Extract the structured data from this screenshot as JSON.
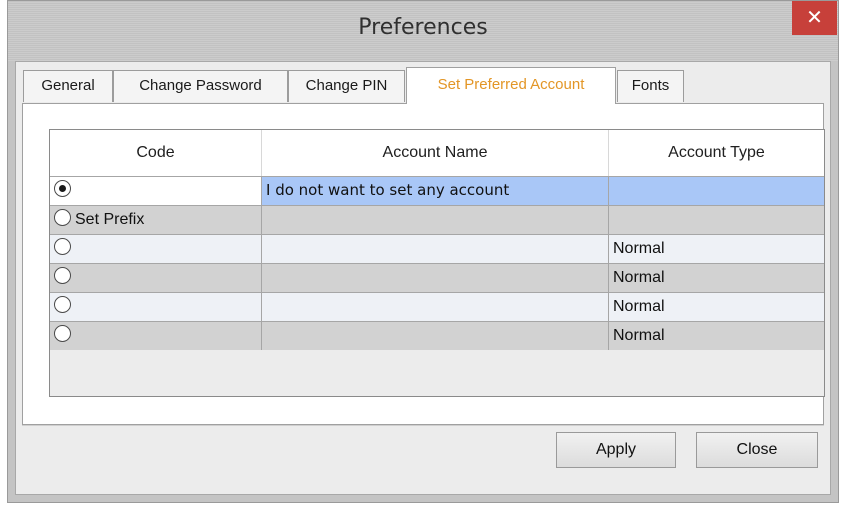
{
  "window": {
    "title": "Preferences",
    "close_glyph": "✕"
  },
  "tabs": [
    {
      "label": "General"
    },
    {
      "label": "Change Password"
    },
    {
      "label": "Change PIN"
    },
    {
      "label": "Set Preferred Account"
    },
    {
      "label": "Fonts"
    }
  ],
  "active_tab": "Set Preferred Account",
  "table": {
    "columns": [
      "Code",
      "Account Name",
      "Account Type"
    ],
    "rows": [
      {
        "selected": true,
        "code": "",
        "account_name": "I do not want to set any account",
        "account_type": ""
      },
      {
        "selected": false,
        "code": "Set Prefix",
        "account_name": "",
        "account_type": ""
      },
      {
        "selected": false,
        "code": "",
        "account_name": "",
        "account_type": "Normal"
      },
      {
        "selected": false,
        "code": "",
        "account_name": "",
        "account_type": "Normal"
      },
      {
        "selected": false,
        "code": "",
        "account_name": "",
        "account_type": "Normal"
      },
      {
        "selected": false,
        "code": "",
        "account_name": "",
        "account_type": "Normal"
      }
    ]
  },
  "buttons": {
    "apply": "Apply",
    "close": "Close"
  },
  "colors": {
    "active_tab_text": "#e39626",
    "selected_row": "#a9c7f7",
    "close_button": "#c7403a"
  },
  "icons": {
    "close": "close-icon",
    "radio_checked": "radio-checked-icon",
    "radio_unchecked": "radio-unchecked-icon"
  }
}
